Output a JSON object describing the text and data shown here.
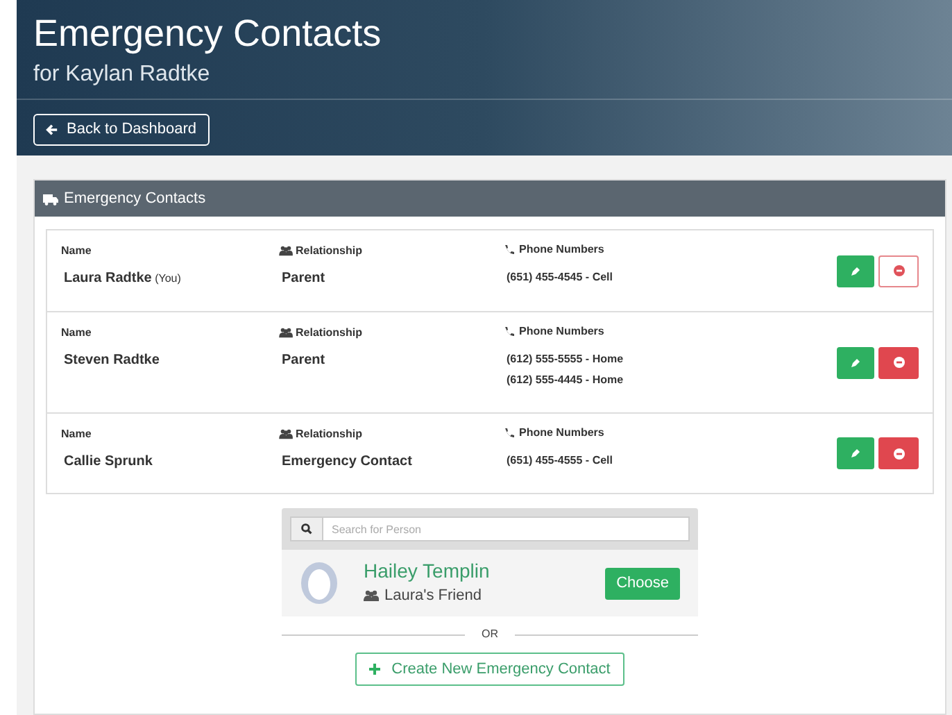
{
  "header": {
    "title": "Emergency Contacts",
    "subtitle": "for Kaylan Radtke",
    "back_button": "Back to Dashboard"
  },
  "panel": {
    "title": "Emergency Contacts"
  },
  "contacts": [
    {
      "name_label": "Name",
      "name": "Laura Radtke",
      "name_note": "(You)",
      "relationship_label": "Relationship",
      "relationship": "Parent",
      "phones_label": "Phone Numbers",
      "phones": [
        "(651) 455-4545 - Cell"
      ],
      "remove_enabled": false
    },
    {
      "name_label": "Name",
      "name": "Steven Radtke",
      "relationship_label": "Relationship",
      "relationship": "Parent",
      "phones_label": "Phone Numbers",
      "phones": [
        "(612) 555-5555 - Home",
        "(612) 555-4445 - Home"
      ],
      "remove_enabled": true
    },
    {
      "name_label": "Name",
      "name": "Callie Sprunk",
      "relationship_label": "Relationship",
      "relationship": "Emergency Contact",
      "phones_label": "Phone Numbers",
      "phones": [
        "(651) 455-4555 - Cell"
      ],
      "remove_enabled": true
    }
  ],
  "search": {
    "placeholder": "Search for Person",
    "result": {
      "name": "Hailey Templin",
      "relation": "Laura's Friend",
      "button": "Choose"
    }
  },
  "divider": "OR",
  "create_button": "Create New Emergency Contact"
}
